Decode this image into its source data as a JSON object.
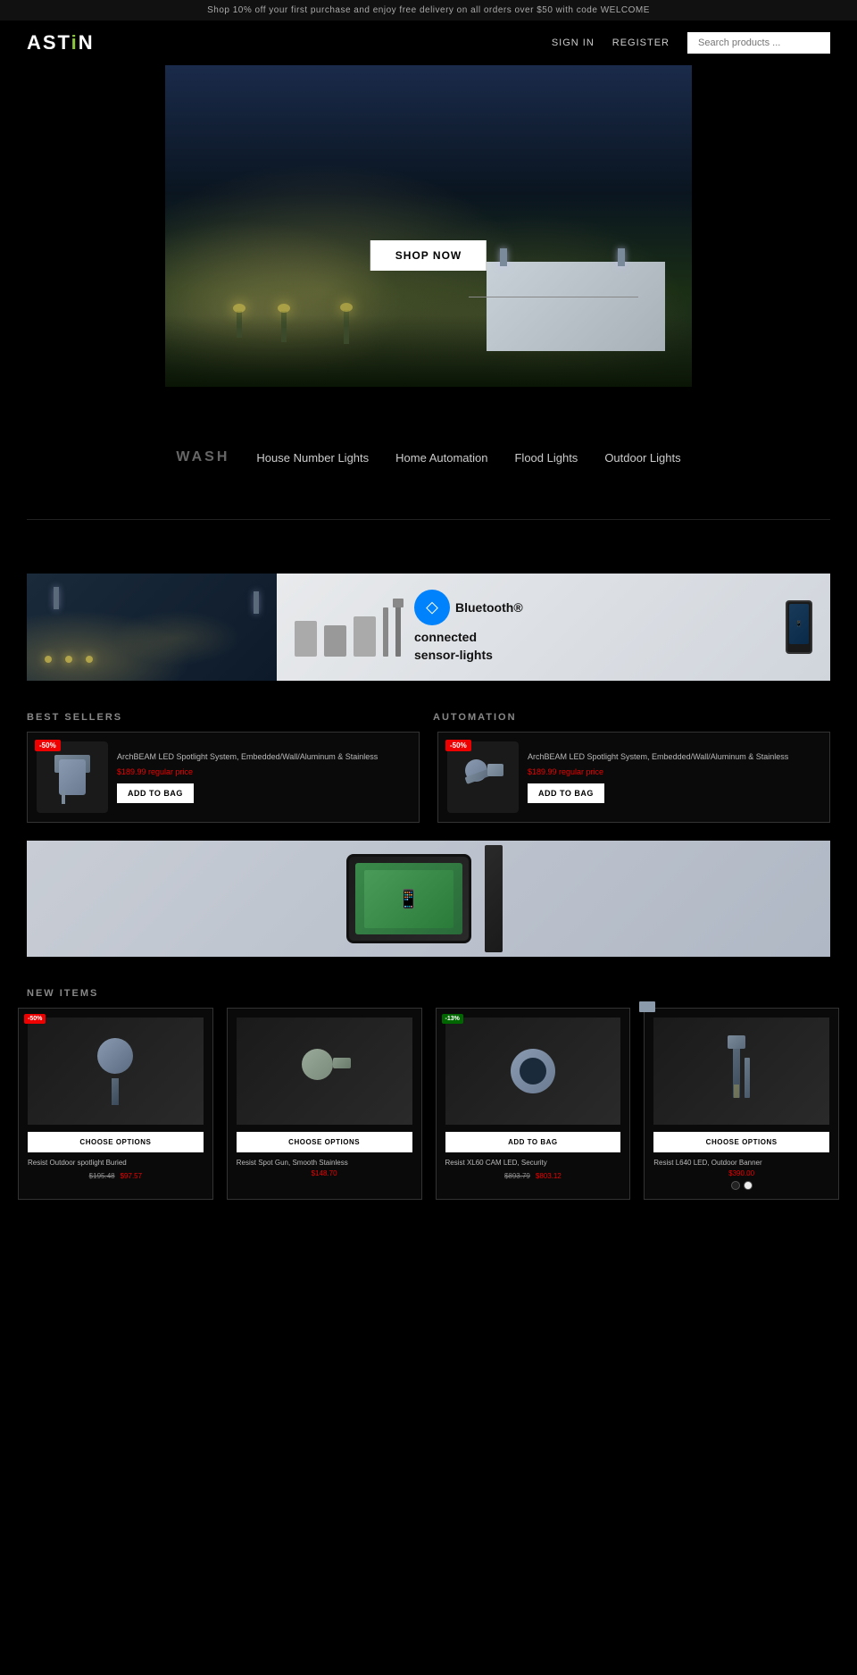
{
  "announcement": {
    "text": "Shop 10% off your first purchase and enjoy free delivery on all orders over $50 with code WELCOME"
  },
  "header": {
    "logo_text": "ASTIN",
    "logo_accent": "i",
    "sign_in": "SIGN IN",
    "register": "REGISTER",
    "search_placeholder": "Search products ..."
  },
  "hero": {
    "shop_now": "SHOP NOW"
  },
  "nav": {
    "wash_label": "WASH",
    "links": [
      "House Number Lights",
      "Home Automation",
      "Flood Lights",
      "Outdoor Lights"
    ]
  },
  "banners": {
    "bluetooth_title": "Bluetooth®",
    "bluetooth_sub": "connected\nsensor-lights"
  },
  "bestsellers": {
    "heading": "BEST SELLERS",
    "products": [
      {
        "badge": "-50%",
        "title": "ArchBEAM LED Spotlight System, Embedded/Wall/Aluminum & Stainless",
        "price": "$189.99 regular price",
        "button": "ADD TO BAG"
      },
      {
        "badge": "-50%",
        "title": "ArchBEAM LED Spotlight System, Embedded/Wall/Aluminum & Stainless",
        "price": "$189.99 regular price",
        "button": "ADD TO BAG"
      }
    ]
  },
  "automation": {
    "heading": "AUTOMATION"
  },
  "new_items": {
    "heading": "NEW ITEMS",
    "products": [
      {
        "badge": "-50%",
        "badge_type": "red",
        "title": "Resist Outdoor spotlight Buried",
        "price": "$195.48",
        "sale_price": "$97.57",
        "button": "CHOOSE OPTIONS",
        "has_swatches": false
      },
      {
        "badge": "",
        "badge_type": "",
        "title": "Resist Spot Gun, Smooth Stainless",
        "price": "$148.70",
        "sale_price": "",
        "button": "CHOOSE OPTIONS",
        "has_swatches": false
      },
      {
        "badge": "-13%",
        "badge_type": "green",
        "title": "Resist XL60 CAM LED, Security",
        "price": "$893.79",
        "sale_price": "$803.12",
        "button": "ADD TO BAG",
        "has_swatches": false
      },
      {
        "badge": "",
        "badge_type": "",
        "title": "Resist L640 LED, Outdoor Banner",
        "price": "$390.00",
        "sale_price": "",
        "button": "CHOOSE OPTIONS",
        "has_swatches": true
      }
    ]
  }
}
